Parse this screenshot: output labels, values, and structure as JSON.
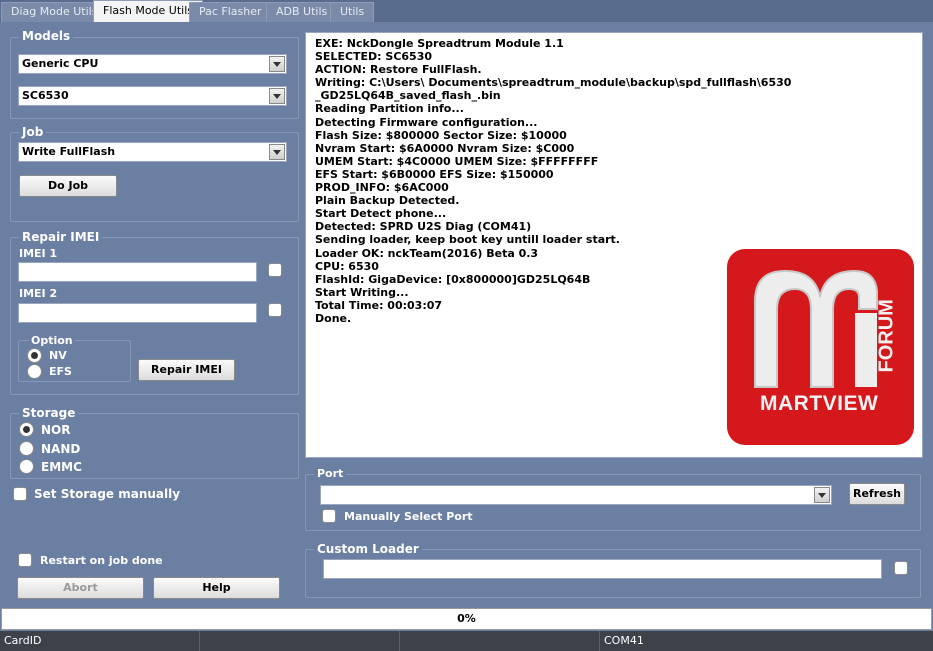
{
  "tabs": [
    "Diag Mode Utils",
    "Flash Mode Utils",
    "Pac Flasher",
    "ADB Utils",
    "Utils"
  ],
  "models": {
    "title": "Models",
    "cpu_value": "Generic CPU",
    "model_value": "SC6530"
  },
  "job": {
    "title": "Job",
    "job_value": "Write FullFlash",
    "do_job_label": "Do Job"
  },
  "repair_imei": {
    "title": "Repair IMEI",
    "imei1_label": "IMEI 1",
    "imei2_label": "IMEI 2",
    "imei1_value": "",
    "imei2_value": "",
    "option_title": "Option",
    "options": [
      "NV",
      "EFS"
    ],
    "repair_label": "Repair IMEI"
  },
  "storage": {
    "title": "Storage",
    "options": [
      "NOR",
      "NAND",
      "EMMC"
    ],
    "set_manually_label": "Set Storage manually"
  },
  "restart_label": "Restart on job done",
  "abort_label": "Abort",
  "help_label": "Help",
  "log_lines": [
    "EXE: NckDongle Spreadtrum Module 1.1",
    "SELECTED: SC6530",
    "ACTION: Restore FullFlash.",
    "Writing: C:\\Users\\ Documents\\spreadtrum_module\\backup\\spd_fullflash\\6530",
    "_GD25LQ64B_saved_flash_.bin",
    "Reading Partition info...",
    "Detecting Firmware configuration...",
    "Flash Size: $800000 Sector Size: $10000",
    "Nvram Start: $6A0000 Nvram Size: $C000",
    "UMEM Start: $4C0000 UMEM Size: $FFFFFFFF",
    "EFS Start: $6B0000 EFS Size: $150000",
    "PROD_INFO: $6AC000",
    "Plain Backup Detected.",
    "Start Detect phone...",
    "Detected: SPRD U2S Diag (COM41)",
    "Sending loader, keep boot key untill loader start.",
    "Loader OK: nckTeam(2016) Beta 0.3",
    "CPU: 6530",
    "FlashId: GigaDevice: [0x800000]GD25LQ64B",
    "Start Writing...",
    "Total Time: 00:03:07",
    "Done."
  ],
  "logo": {
    "brand": "MARTVIEW",
    "side_text": "FORUM",
    "color": "#d4181c"
  },
  "port": {
    "title": "Port",
    "value": "",
    "refresh_label": "Refresh",
    "manual_label": "Manually Select Port"
  },
  "custom_loader": {
    "title": "Custom Loader",
    "value": ""
  },
  "progress_text": "0%",
  "status_bar": {
    "card_id": "CardID",
    "port": "COM41"
  }
}
